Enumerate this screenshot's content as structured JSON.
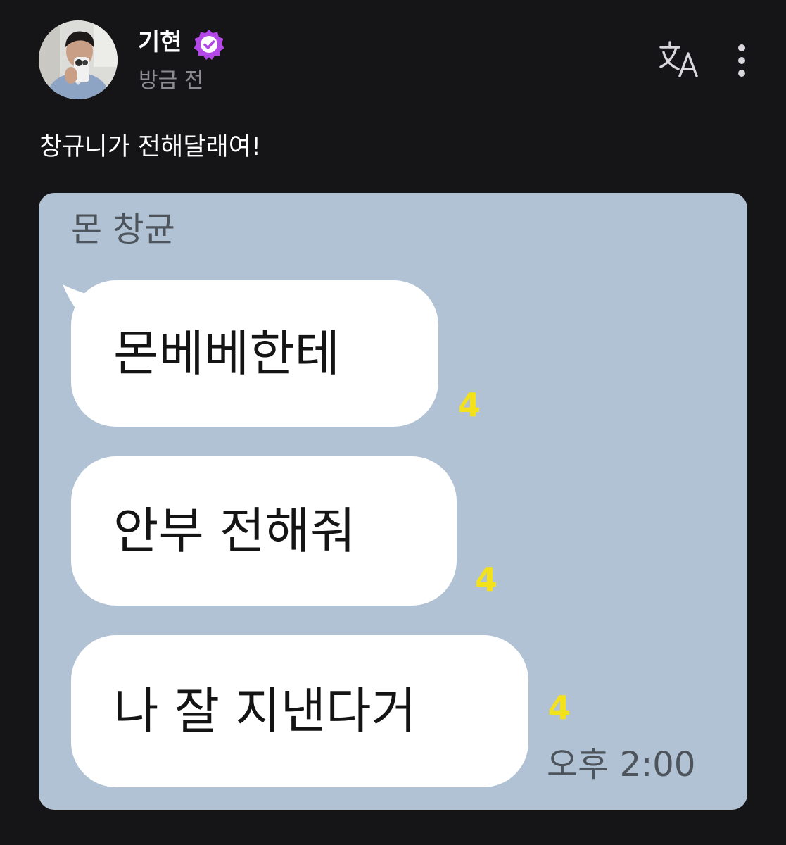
{
  "post": {
    "author": {
      "name": "기현",
      "avatar_icon": "profile-photo",
      "verified_icon": "verified-badge-icon",
      "verified_color": "#b347e8"
    },
    "time": "방금 전",
    "actions": {
      "translate_icon": "translate-icon",
      "more_icon": "more-vertical-icon"
    },
    "caption": "창규니가 전해달래여!"
  },
  "attachment": {
    "background_color": "#b1c2d4",
    "sender": "몬 창균",
    "messages": [
      {
        "text": "몬베베한테",
        "unread": "4"
      },
      {
        "text": "안부 전해줘",
        "unread": "4"
      },
      {
        "text": "나 잘 지낸다거",
        "unread": "4"
      }
    ],
    "time": "오후 2:00",
    "unread_color": "#f3e21b"
  }
}
